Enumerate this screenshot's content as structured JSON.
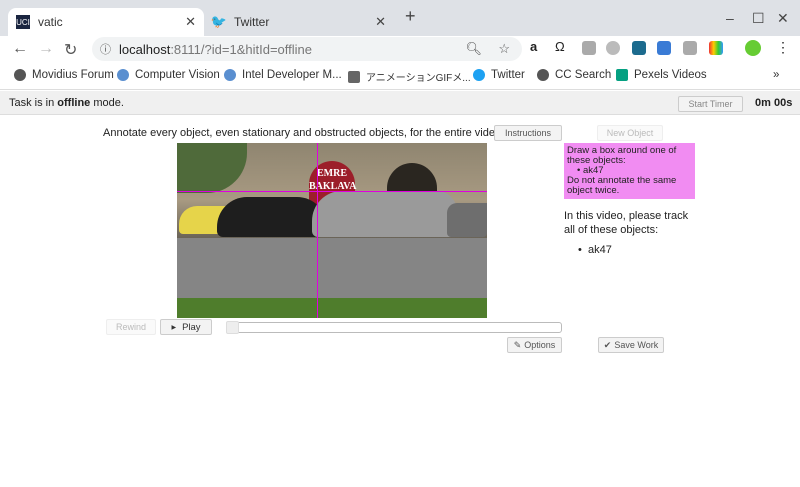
{
  "browser": {
    "tabs": [
      {
        "title": "vatic",
        "icon": "UCI"
      },
      {
        "title": "Twitter"
      }
    ],
    "url_host": "localhost",
    "url_rest": ":8111/?id=1&hitId=offline",
    "bookmarks": [
      "Movidius Forum",
      "Computer Vision",
      "Intel Developer M...",
      "アニメーションGIFメ...",
      "Twitter",
      "CC Search",
      "Pexels Videos"
    ],
    "more": "»"
  },
  "status": {
    "prefix": "Task is in ",
    "mode": "offline",
    "suffix": " mode.",
    "start_timer": "Start Timer",
    "timer": "0m 00s"
  },
  "main": {
    "headline": "Annotate every object, even stationary and obstructed objects, for the entire video.",
    "instructions_btn": "Instructions",
    "new_object_btn": "New Object",
    "prompt": {
      "line1": "Draw a box around one of these objects:",
      "item": "ak47",
      "line2": "Do not annotate the same object twice."
    },
    "track_text": "In this video, please track all of these objects:",
    "track_item": "ak47",
    "rewind_btn": "Rewind",
    "play_btn": "Play",
    "options_btn": "Options",
    "save_btn": "Save Work",
    "video_sign": [
      "EMRE",
      "BAKLAVA"
    ]
  },
  "colors": {
    "crosshair": "#e000e0",
    "prompt_bg": "#f18cf2"
  }
}
